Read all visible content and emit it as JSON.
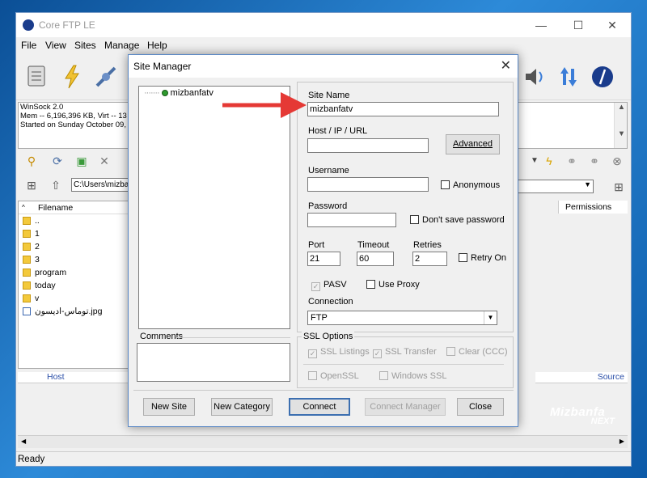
{
  "app": {
    "title": "Core FTP LE",
    "window_controls": [
      "—",
      "☐",
      "✕"
    ],
    "menu": [
      "File",
      "View",
      "Sites",
      "Manage",
      "Help"
    ]
  },
  "log": {
    "lines": [
      "WinSock 2.0",
      "Mem -- 6,196,396 KB, Virt -- 13",
      "Started on Sunday October 09,"
    ]
  },
  "local": {
    "path": "C:\\Users\\mizba",
    "column_filename": "Filename",
    "files": [
      "..",
      "1",
      "2",
      "3",
      "program",
      "today",
      "v",
      "توماس-ادیسون.jpg"
    ],
    "host_label": "Host"
  },
  "remote": {
    "column_permissions": "Permissions",
    "source_label": "Source"
  },
  "status": {
    "text": "Ready"
  },
  "dialog": {
    "title": "Site Manager",
    "tree_item": "mizbanfatv",
    "comments_label": "Comments",
    "site_name_label": "Site Name",
    "site_name_value": "mizbanfatv",
    "host_label": "Host / IP / URL",
    "host_value": "",
    "advanced_label": "Advanced",
    "username_label": "Username",
    "username_value": "",
    "anonymous_label": "Anonymous",
    "password_label": "Password",
    "password_value": "",
    "dont_save_label": "Don't save password",
    "port_label": "Port",
    "port_value": "21",
    "timeout_label": "Timeout",
    "timeout_value": "60",
    "retries_label": "Retries",
    "retries_value": "2",
    "retry_on_label": "Retry On",
    "pasv_label": "PASV",
    "use_proxy_label": "Use Proxy",
    "connection_label": "Connection",
    "connection_value": "FTP",
    "ssl_options_label": "SSL Options",
    "ssl_listings_label": "SSL Listings",
    "ssl_transfer_label": "SSL Transfer",
    "clear_ccc_label": "Clear (CCC)",
    "openssl_label": "OpenSSL",
    "windows_ssl_label": "Windows SSL",
    "new_site_label": "New Site",
    "new_category_label": "New Category",
    "connect_label": "Connect",
    "connect_manager_label": "Connect Manager",
    "close_label": "Close"
  },
  "logo": {
    "line1": "Mizbanfa",
    "line2": "NEXT"
  },
  "colors": {
    "arrow": "#e53935",
    "accent": "#2b4fa8"
  }
}
